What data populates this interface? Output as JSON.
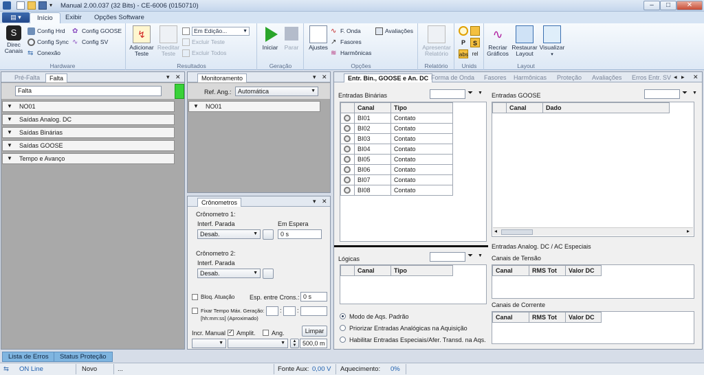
{
  "window": {
    "title": "Manual 2.00.037 (32 Bits) - CE-6006 (0150710)"
  },
  "ribbon_tabs": [
    "Início",
    "Exibir",
    "Opções Software"
  ],
  "ribbon": {
    "hardware": {
      "name": "Hardware",
      "direc_canais": "Direc Canais",
      "config_hrd": "Config Hrd",
      "config_goose": "Config GOOSE",
      "config_sync": "Config Sync",
      "config_sv": "Config SV",
      "conexao": "Conexão"
    },
    "resultados": {
      "name": "Resultados",
      "adicionar_teste": "Adicionar Teste",
      "reeditar_teste": "Reeditar Teste",
      "edit_status": "Em Edição...",
      "excluir_teste": "Excluir Teste",
      "excluir_todos": "Excluir Todos"
    },
    "geracao": {
      "name": "Geração",
      "iniciar": "Iniciar",
      "parar": "Parar"
    },
    "opcoes": {
      "name": "Opções",
      "ajustes": "Ajustes",
      "f_onda": "F. Onda",
      "fasores": "Fasores",
      "harmonicas": "Harmônicas",
      "avaliacoes": "Avaliações"
    },
    "relatorio": {
      "name": "Relatório",
      "apresentar": "Apresentar Relatório"
    },
    "unids": {
      "name": "Unids",
      "abs": "abs",
      "rel": "rel",
      "p": "P",
      "s": "S"
    },
    "layout": {
      "name": "Layout",
      "recriar": "Recriar Gráficos",
      "restaurar": "Restaurar Layout",
      "visualizar": "Visualizar"
    }
  },
  "left_panel": {
    "tabs": [
      "Pré-Falta",
      "Falta"
    ],
    "search_value": "Falta",
    "tree": [
      "NO01",
      "Saídas Analog. DC",
      "Saídas Binárias",
      "Saídas GOOSE",
      "Tempo e Avanço"
    ]
  },
  "monitor_panel": {
    "tab": "Monitoramento",
    "ref_ang_label": "Ref. Ang.:",
    "ref_ang_value": "Automática",
    "tree": [
      "NO01"
    ]
  },
  "crono_panel": {
    "tab": "Crônometros",
    "crono1": "Crônometro 1:",
    "interf_parada": "Interf. Parada",
    "em_espera": "Em Espera",
    "crono1_select": "Desab.",
    "crono1_value": "0 s",
    "crono2": "Crônometro 2:",
    "crono2_select": "Desab.",
    "bloq_atuacao": "Bloq. Atuação",
    "esp_entre_crons": "Esp. entre Crons.:",
    "esp_value": "0 s",
    "fixar_tempo": "Fixar Tempo Máx. Geração:",
    "fixar_format": "[hh:mm:ss] (Aproximado)",
    "limpar": "Limpar",
    "incr_manual": "Incr. Manual",
    "amplit": "Amplit.",
    "ang": "Ang.",
    "step_value": "500,0 m"
  },
  "right_panel": {
    "tabs": [
      "Entr. Bin., GOOSE e An. DC",
      "Forma de Onda",
      "Fasores",
      "Harmônicas",
      "Proteção",
      "Avaliações",
      "Erros Entr. SV"
    ],
    "entradas_binarias": "Entradas Binárias",
    "entradas_goose": "Entradas GOOSE",
    "bin_headers": [
      "Canal",
      "Tipo"
    ],
    "bin_rows": [
      [
        "BI01",
        "Contato"
      ],
      [
        "BI02",
        "Contato"
      ],
      [
        "BI03",
        "Contato"
      ],
      [
        "BI04",
        "Contato"
      ],
      [
        "BI05",
        "Contato"
      ],
      [
        "BI06",
        "Contato"
      ],
      [
        "BI07",
        "Contato"
      ],
      [
        "BI08",
        "Contato"
      ]
    ],
    "goose_headers": [
      "Canal",
      "Dado"
    ],
    "logicas": "Lógicas",
    "logicas_headers": [
      "Canal",
      "Tipo"
    ],
    "entradas_analog": "Entradas Analog. DC / AC Especiais",
    "canais_tensao": "Canais de Tensão",
    "canais_corrente": "Canais de Corrente",
    "analog_headers": [
      "Canal",
      "RMS Tot",
      "Valor DC"
    ],
    "radios": [
      "Modo de Aqs. Padrão",
      "Priorizar Entradas Analógicas na Aquisição",
      "Habilitar Entradas Especiais/Afer. Transd. na Aqs."
    ]
  },
  "bottom_tabs": [
    "Lista de Erros",
    "Status Proteção"
  ],
  "status": {
    "online": "ON Line",
    "novo": "Novo",
    "dots": "...",
    "fonte_aux_label": "Fonte Aux:",
    "fonte_aux_value": "0,00 V",
    "aquecimento_label": "Aquecimento:",
    "aquecimento_value": "0%"
  }
}
